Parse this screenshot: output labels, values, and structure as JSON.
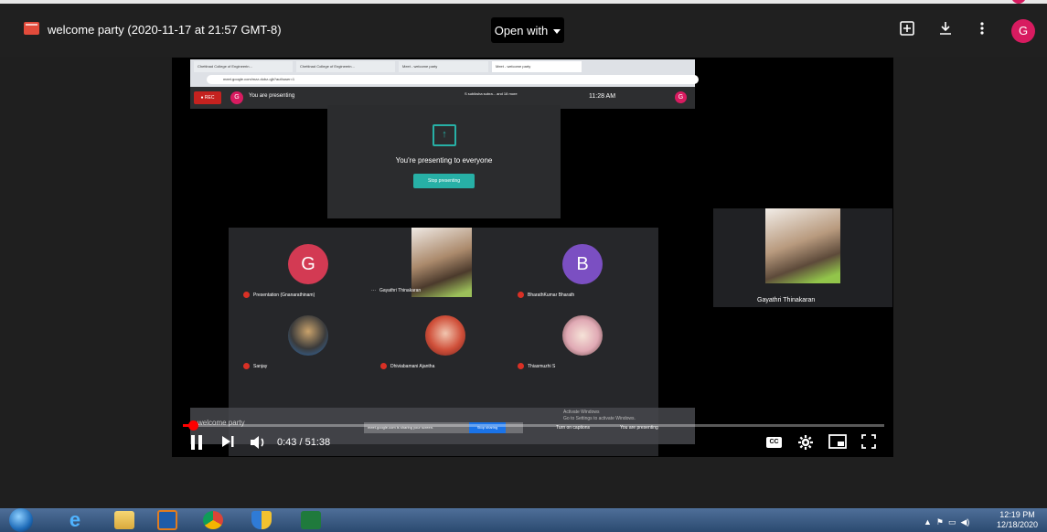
{
  "viewer": {
    "title": "welcome party (2020-11-17 at 21:57 GMT-8)",
    "open_with": "Open with",
    "icons": {
      "add": "add-to-drive-icon",
      "download": "download-icon",
      "more": "more-vert-icon"
    },
    "account_initial": "G"
  },
  "captured": {
    "tabs": [
      "Chettinad College of Engineerin...",
      "Chettinad College of Engineerin...",
      "Meet - welcome party",
      "Meet - welcome party"
    ],
    "url": "meet.google.com/mzz-dubz-qjb?authuser=1",
    "rec_label": "● REC",
    "account_initial": "G",
    "presenting_label": "You are presenting",
    "participants": "S subiksha subra... and 18 more",
    "clock": "11:28 AM",
    "presenting_card": {
      "message": "You're presenting to everyone",
      "stop_button": "Stop presenting"
    },
    "tiles": [
      {
        "name": "Presentation (Gnanarathinam)",
        "initial": "G",
        "color": "#d33a53"
      },
      {
        "name": "Gayathri Thinakaran",
        "initial": "",
        "color": "#9cc05a"
      },
      {
        "name": "BharathKumar Bharath",
        "initial": "B",
        "color": "#7b4fc2"
      },
      {
        "name": "Sanjay",
        "initial": "",
        "color": "#3b6fb0"
      },
      {
        "name": "Dhiviabamani Ajantha",
        "initial": "",
        "color": "#d0503a"
      },
      {
        "name": "Thiasmuzhi S",
        "initial": "",
        "color": "#e0a9b4"
      }
    ],
    "sharing_bar": {
      "file_name": "welcome party",
      "notice": "meet.google.com is sharing your screen.",
      "stop_sharing": "Stop sharing",
      "hide": "Hide",
      "captions": "Turn on captions",
      "presenting": "You are presenting",
      "activate": "Activate Windows",
      "activate_sub": "Go to Settings to activate Windows."
    }
  },
  "side_tile": {
    "name": "Gayathri Thinakaran"
  },
  "player": {
    "time": "0:43 / 51:38",
    "progress_fraction": 0.014,
    "cc_label": "CC"
  },
  "taskbar": {
    "time": "12:19 PM",
    "date": "12/18/2020"
  }
}
